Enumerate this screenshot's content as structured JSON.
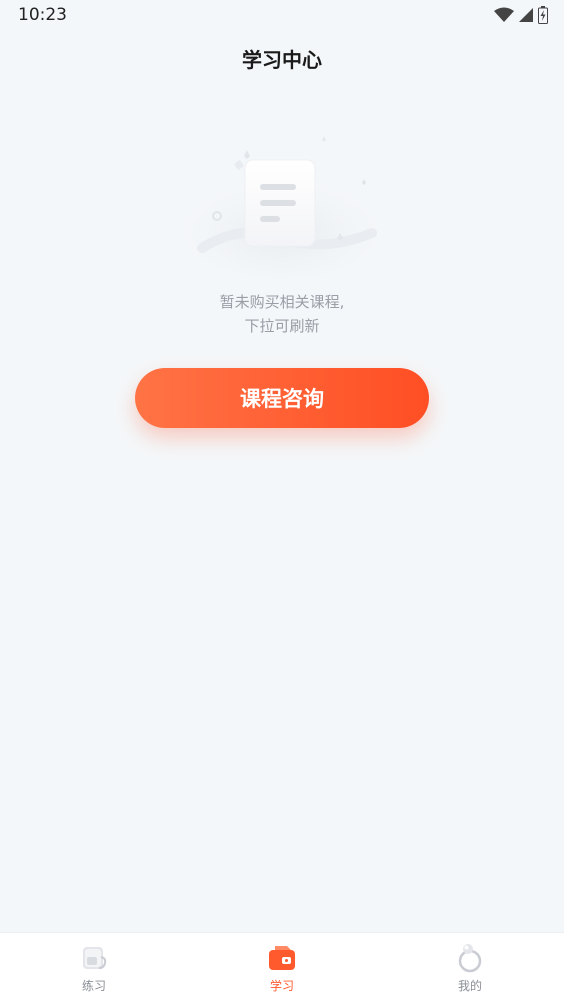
{
  "status_bar": {
    "time": "10:23"
  },
  "header": {
    "title": "学习中心"
  },
  "empty_state": {
    "line1": "暂未购买相关课程,",
    "line2": "下拉可刷新"
  },
  "action": {
    "consult_label": "课程咨询"
  },
  "bottom_nav": {
    "items": [
      {
        "label": "练习",
        "icon": "practice-icon",
        "active": false
      },
      {
        "label": "学习",
        "icon": "study-icon",
        "active": true
      },
      {
        "label": "我的",
        "icon": "profile-icon",
        "active": false
      }
    ]
  },
  "colors": {
    "accent": "#ff5a2e",
    "background": "#f4f7f9",
    "muted_text": "#9a9ea6"
  }
}
